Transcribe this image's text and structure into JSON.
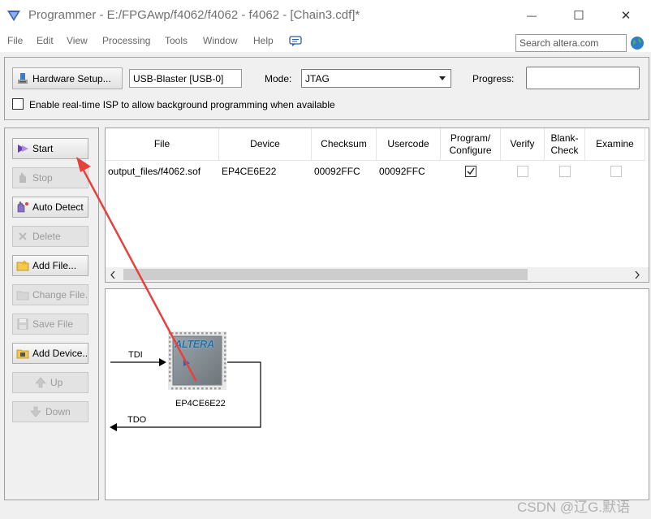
{
  "window": {
    "title": "Programmer - E:/FPGAwp/f4062/f4062 - f4062 - [Chain3.cdf]*",
    "minimize_glyph": "—",
    "maximize_glyph": "☐",
    "close_glyph": "✕"
  },
  "menu": {
    "items": [
      "File",
      "Edit",
      "View",
      "Processing",
      "Tools",
      "Window",
      "Help"
    ],
    "search_placeholder": "Search altera.com"
  },
  "toolbar": {
    "hardware_setup_label": "Hardware Setup...",
    "hardware_value": "USB-Blaster [USB-0]",
    "mode_label": "Mode:",
    "mode_value": "JTAG",
    "progress_label": "Progress:",
    "isp_label": "Enable real-time ISP to allow background programming when available",
    "isp_checked": false
  },
  "sidebar": {
    "buttons": [
      {
        "label": "Start",
        "icon": "start-icon",
        "enabled": true
      },
      {
        "label": "Stop",
        "icon": "stop-icon",
        "enabled": false
      },
      {
        "label": "Auto Detect",
        "icon": "auto-detect-icon",
        "enabled": true
      },
      {
        "label": "Delete",
        "icon": "delete-icon",
        "enabled": false
      },
      {
        "label": "Add File...",
        "icon": "add-file-icon",
        "enabled": true
      },
      {
        "label": "Change File...",
        "icon": "change-file-icon",
        "enabled": false
      },
      {
        "label": "Save File",
        "icon": "save-file-icon",
        "enabled": false
      },
      {
        "label": "Add Device...",
        "icon": "add-device-icon",
        "enabled": true
      },
      {
        "label": "Up",
        "icon": "up-icon",
        "enabled": false
      },
      {
        "label": "Down",
        "icon": "down-icon",
        "enabled": false
      }
    ]
  },
  "table": {
    "headers": [
      "File",
      "Device",
      "Checksum",
      "Usercode",
      "Program/\nConfigure",
      "Verify",
      "Blank-\nCheck",
      "Examine"
    ],
    "rows": [
      {
        "file": "output_files/f4062.sof",
        "device": "EP4CE6E22",
        "checksum": "00092FFC",
        "usercode": "00092FFC",
        "program": true,
        "verify": false,
        "blank_check": false,
        "examine": false
      }
    ]
  },
  "chain": {
    "tdi_label": "TDI",
    "tdo_label": "TDO",
    "chip_logo": "ALTERA",
    "device_label": "EP4CE6E22"
  },
  "watermark": "CSDN @辽G.默语",
  "colors": {
    "annotation_arrow": "#e8403c",
    "chip_body": "#8a9298",
    "chip_logo": "#1e6fa8"
  }
}
